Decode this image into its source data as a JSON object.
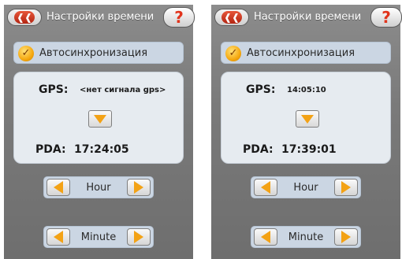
{
  "screens": [
    {
      "title": "Настройки времени",
      "back_icon": "arrow-left",
      "help_icon": "?",
      "autosync": {
        "label": "Автосинхронизация",
        "checked": true
      },
      "gps": {
        "label": "GPS:",
        "value": "<нет сигнала gps>"
      },
      "pda": {
        "label": "PDA:",
        "value": "17:24:05"
      },
      "hour": {
        "label": "Hour"
      },
      "minute": {
        "label": "Minute"
      }
    },
    {
      "title": "Настройки времени",
      "back_icon": "arrow-left",
      "help_icon": "?",
      "autosync": {
        "label": "Автосинхронизация",
        "checked": true
      },
      "gps": {
        "label": "GPS:",
        "value": "14:05:10"
      },
      "pda": {
        "label": "PDA:",
        "value": "17:39:01"
      },
      "hour": {
        "label": "Hour"
      },
      "minute": {
        "label": "Minute"
      }
    }
  ],
  "colors": {
    "accent_orange": "#f3a215",
    "back_red": "#d1381f",
    "panel_gray": "#7a7a7a",
    "info_bg": "#e6ebf0",
    "control_bg": "#cbd6e3"
  }
}
